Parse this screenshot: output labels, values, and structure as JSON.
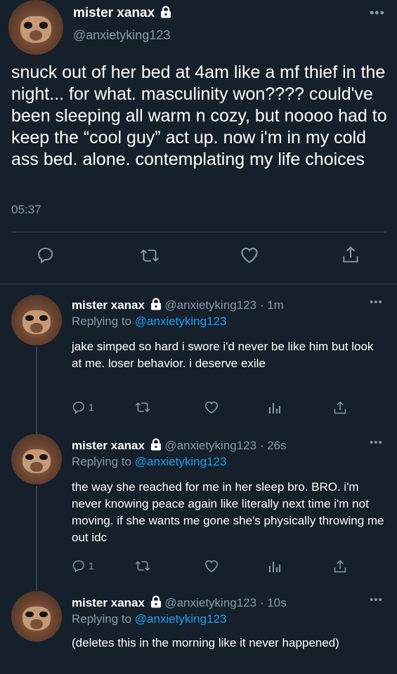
{
  "main": {
    "name": "mister xanax",
    "handle": "@anxietyking123",
    "text": "snuck out of her bed at 4am like a mf thief in the night... for what. masculinity won???? could've been sleeping all warm n cozy, but noooo had to keep the “cool guy” act up. now i'm in my cold ass bed. alone. contemplating my life choices",
    "time": "05:37",
    "actions": [
      "reply-icon",
      "retweet-icon",
      "like-icon",
      "share-icon"
    ]
  },
  "replies": [
    {
      "name": "mister xanax",
      "handle": "@anxietyking123 · 1m",
      "replying_prefix": "Replying to ",
      "replying_to": "@anxietyking123",
      "text": "jake simped so hard i swore i'd never be like him but look at me. loser behavior. i deserve exile",
      "reply_count": "1"
    },
    {
      "name": "mister xanax",
      "handle": "@anxietyking123 · 26s",
      "replying_prefix": "Replying to ",
      "replying_to": "@anxietyking123",
      "text": "the way she reached for me in her sleep bro. BRO. i'm never knowing peace again like literally next time i'm not moving. if she wants me gone she's physically throwing me out idc",
      "reply_count": "1"
    },
    {
      "name": "mister xanax",
      "handle": "@anxietyking123 · 10s",
      "replying_prefix": "Replying to ",
      "replying_to": "@anxietyking123",
      "text": "(deletes this in the morning like it never happened)"
    }
  ],
  "colors": {
    "background": "#15202b",
    "muted": "#8899a6",
    "link": "#1da1f2",
    "divider": "#38444d"
  }
}
